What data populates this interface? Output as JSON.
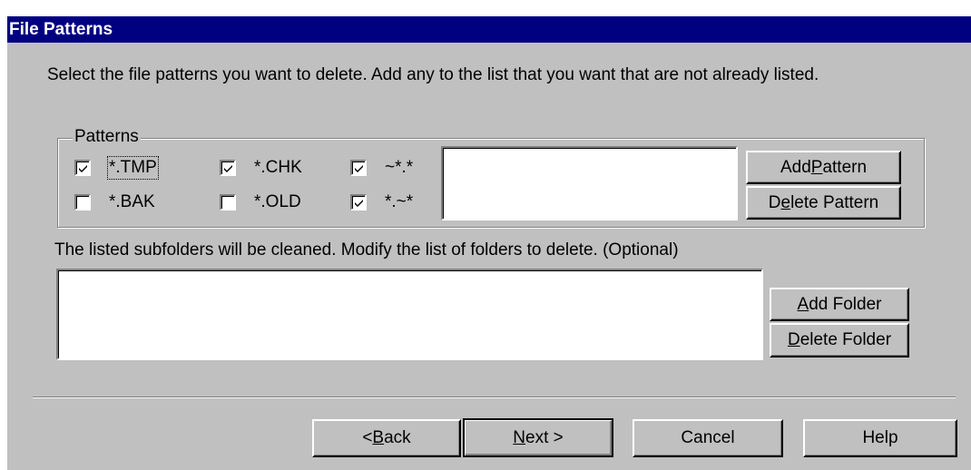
{
  "window": {
    "title": "File Patterns"
  },
  "intro": {
    "text": "Select the file patterns you want to delete.  Add any to the list that you want that are not already listed."
  },
  "patterns": {
    "group_label": "Patterns",
    "items": [
      {
        "label": "*.TMP",
        "checked": true
      },
      {
        "label": "*.CHK",
        "checked": true
      },
      {
        "label": "~*.*",
        "checked": true
      },
      {
        "label": "*.BAK",
        "checked": false
      },
      {
        "label": "*.OLD",
        "checked": false
      },
      {
        "label": "*.~*",
        "checked": true
      }
    ],
    "add_button": {
      "pre": "Add ",
      "accel": "P",
      "post": "attern"
    },
    "delete_button": {
      "pre": "D",
      "accel": "e",
      "post": "lete Pattern"
    }
  },
  "folders": {
    "text": "The listed subfolders will be cleaned.  Modify the list of folders to delete. (Optional)",
    "add_button": {
      "pre": "",
      "accel": "A",
      "post": "dd Folder"
    },
    "delete_button": {
      "pre": "",
      "accel": "D",
      "post": "elete Folder"
    }
  },
  "footer": {
    "back_button": {
      "pre": "< ",
      "accel": "B",
      "post": "ack"
    },
    "next_button": {
      "pre": "",
      "accel": "N",
      "post": "ext >"
    },
    "cancel_label": "Cancel",
    "help_label": "Help"
  },
  "colors": {
    "titlebar": "#000080",
    "face": "#c0c0c0"
  }
}
